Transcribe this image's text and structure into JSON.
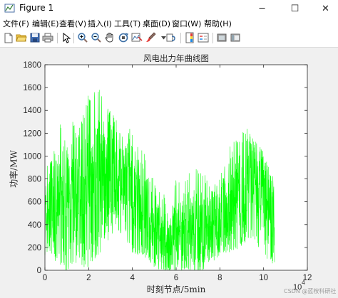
{
  "window": {
    "title": "Figure 1",
    "minimize": "─",
    "maximize": "☐",
    "close": "✕"
  },
  "menu": [
    "文件(F)",
    "编辑(E)",
    "查看(V)",
    "插入(I)",
    "工具(T)",
    "桌面(D)",
    "窗口(W)",
    "帮助(H)"
  ],
  "toolbar": [
    "new-file-icon",
    "open-folder-icon",
    "save-icon",
    "print-icon",
    "select-arrow-icon",
    "zoom-in-icon",
    "zoom-out-icon",
    "pan-hand-icon",
    "rotate-3d-icon",
    "data-cursor-icon",
    "brush-icon",
    "link-plot-icon",
    "colorbar-icon",
    "legend-icon",
    "hide-plot-tools-icon",
    "show-plot-tools-icon"
  ],
  "colors": {
    "line": "#00ff00",
    "axes_bg": "#ffffff",
    "figure_bg": "#f0f0f0"
  },
  "chart_data": {
    "type": "line",
    "title": "风电出力年曲线图",
    "xlabel": "时刻节点/5min",
    "ylabel": "功率/MW",
    "x_exponent_label": "10",
    "x_exponent": "4",
    "xlim": [
      0,
      12
    ],
    "ylim": [
      0,
      1800
    ],
    "xticks": [
      0,
      2,
      4,
      6,
      8,
      10,
      12
    ],
    "yticks": [
      0,
      200,
      400,
      600,
      800,
      1000,
      1200,
      1400,
      1600,
      1800
    ],
    "series": [
      {
        "x_end": 10.5,
        "envelope": [
          {
            "x": 0.0,
            "low": 200,
            "mid": 450,
            "high": 900
          },
          {
            "x": 0.5,
            "low": 100,
            "mid": 520,
            "high": 1100
          },
          {
            "x": 1.0,
            "low": 150,
            "mid": 600,
            "high": 1550
          },
          {
            "x": 1.5,
            "low": 120,
            "mid": 550,
            "high": 1200
          },
          {
            "x": 2.0,
            "low": 150,
            "mid": 620,
            "high": 1550
          },
          {
            "x": 2.5,
            "low": 250,
            "mid": 720,
            "high": 1600
          },
          {
            "x": 3.0,
            "low": 300,
            "mid": 800,
            "high": 1400
          },
          {
            "x": 3.5,
            "low": 300,
            "mid": 780,
            "high": 1250
          },
          {
            "x": 4.0,
            "low": 150,
            "mid": 650,
            "high": 1250
          },
          {
            "x": 4.5,
            "low": 100,
            "mid": 500,
            "high": 1050
          },
          {
            "x": 5.0,
            "low": 50,
            "mid": 350,
            "high": 800
          },
          {
            "x": 5.5,
            "low": 0,
            "mid": 200,
            "high": 650
          },
          {
            "x": 6.0,
            "low": 30,
            "mid": 300,
            "high": 800
          },
          {
            "x": 6.5,
            "low": 80,
            "mid": 350,
            "high": 850
          },
          {
            "x": 7.0,
            "low": 50,
            "mid": 330,
            "high": 900
          },
          {
            "x": 7.5,
            "low": 80,
            "mid": 350,
            "high": 800
          },
          {
            "x": 8.0,
            "low": 120,
            "mid": 450,
            "high": 850
          },
          {
            "x": 8.5,
            "low": 150,
            "mid": 600,
            "high": 1100
          },
          {
            "x": 9.0,
            "low": 200,
            "mid": 700,
            "high": 1300
          },
          {
            "x": 9.5,
            "low": 250,
            "mid": 750,
            "high": 1200
          },
          {
            "x": 10.0,
            "low": 100,
            "mid": 600,
            "high": 1050
          },
          {
            "x": 10.5,
            "low": 50,
            "mid": 400,
            "high": 800
          }
        ]
      }
    ]
  },
  "watermark": "CSDN @蓝桉科研社"
}
